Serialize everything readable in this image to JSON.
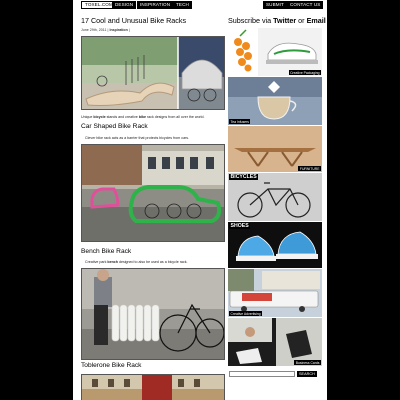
{
  "nav": {
    "logo": "TOXEL.COM",
    "items": [
      "DESIGN",
      "INSPIRATION",
      "TECH"
    ],
    "submit": "SUBMIT",
    "contact": "CONTACT US"
  },
  "post": {
    "title": "17 Cool and Unusual Bike Racks",
    "date": "June 29th, 2011 |",
    "category": "Inspiration",
    "intro_a": "Unique ",
    "intro_b": "bicycle",
    "intro_c": " stands and creative ",
    "intro_d": "bike",
    "intro_e": " rack designs from all over the world."
  },
  "sections": [
    {
      "title": "Car Shaped Bike Rack",
      "caption": "Clever bike rack acts as a barrier that protects bicycles from cars."
    },
    {
      "title": "Bench Bike Rack",
      "caption_a": "Creative park ",
      "caption_b": "bench",
      "caption_c": " designed to also be used as a bicycle rack."
    },
    {
      "title": "Toblerone Bike Rack"
    }
  ],
  "sidebar": {
    "subscribe_a": "Subscribe via ",
    "subscribe_b": "Twitter",
    "subscribe_c": " or ",
    "subscribe_d": "Email",
    "tiles": {
      "packaging": "Creative Packaging",
      "tea": "Tea Infusers",
      "furniture": "FURNITURE",
      "bicycles": "BICYCLES",
      "shoes": "SHOES",
      "advertising": "Creative Advertising",
      "cards": "Business Cards"
    },
    "search_button": "SEARCH"
  }
}
